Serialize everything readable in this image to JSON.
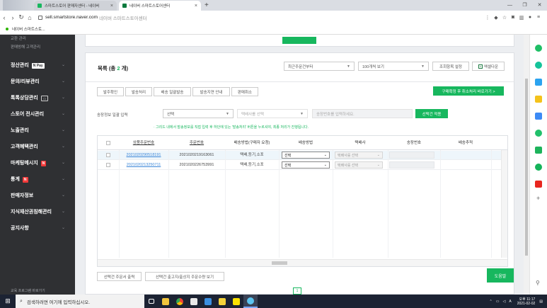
{
  "browser": {
    "tabs": [
      {
        "title": "스마트스토어 판매자센터 - 네이버",
        "active": false
      },
      {
        "title": "네이버 스마트스토어센터",
        "active": true
      }
    ],
    "url_host": "sell.smartstore.naver.com",
    "url_title": "네이버 스마트스토어센터",
    "bookmark": "네이버 스마트스토..."
  },
  "sidebar": {
    "sub_items": [
      "교환 관리",
      "판매방해 고객관리"
    ],
    "items": [
      {
        "label": "정산관리",
        "badge": "N Pay"
      },
      {
        "label": "문의/리뷰관리",
        "badge": ""
      },
      {
        "label": "톡톡상담관리",
        "badge": ""
      },
      {
        "label": "스토어 전시관리",
        "badge": ""
      },
      {
        "label": "노출관리",
        "badge": ""
      },
      {
        "label": "고객혜택관리",
        "badge": ""
      },
      {
        "label": "마케팅메시지",
        "badge": "N"
      },
      {
        "label": "통계",
        "badge": "N"
      },
      {
        "label": "판매자정보",
        "badge": ""
      },
      {
        "label": "지식재산권침해관리",
        "badge": ""
      },
      {
        "label": "공지사항",
        "badge": ""
      }
    ],
    "bottom_link": "교육 프로그램 바로가기"
  },
  "list": {
    "title_prefix": "목록 (총 ",
    "count": "2",
    "title_suffix": " 개)",
    "sort_select": "최근주문건부터",
    "per_page_select": "100개씩 보기",
    "column_settings_btn": "조회항목 설정",
    "excel_btn": "엑셀다운",
    "action_buttons": [
      "발주확인",
      "발송처리",
      "배송 일괄발송",
      "발송지연 안내",
      "판매취소"
    ],
    "cancel_return_btn": "구매확정 후 취소처리 바로가기 >",
    "bulk_label": "송장정보 일괄 입력",
    "bulk_method_select": "선택",
    "bulk_courier_select": "택배사를 선택",
    "bulk_tracking_placeholder": "송장번호를 입력하세요.",
    "bulk_apply_btn": "선택건 적용",
    "notice": "· 그리드 내에서 발송정보를 직접 입력 후 하단에 있는 '발송처리' 버튼을 누르셔야, 최종 처리가 진행됩니다.",
    "columns": [
      "상품주문번호",
      "주문번호",
      "배송방법(구매자 요청)",
      "배송방법",
      "택배사",
      "송장번호",
      "배송추적"
    ],
    "rows": [
      {
        "product_order_no": "2021020290518191",
        "order_no": "2021020219163061",
        "req_method": "택배,등기,소포",
        "method": "선택",
        "courier": "택배사를 선택"
      },
      {
        "product_order_no": "2021020213250711",
        "order_no": "2021020226753991",
        "req_method": "택배,등기,소포",
        "method": "선택",
        "courier": "택배사를 선택"
      }
    ],
    "bottom_buttons": [
      "선택건 주문서 출력",
      "선택건 출고지/출상지 주문수량 보기"
    ],
    "help_btn": "도움말",
    "page": "1"
  },
  "taskbar": {
    "search_placeholder": "검색하려면 여기에 입력하십시오.",
    "time": "오후 11:17",
    "date": "2021-02-02"
  },
  "colors": {
    "accent": "#17b75e",
    "sidebar_bg": "#2f3033",
    "link": "#3b86d8"
  }
}
